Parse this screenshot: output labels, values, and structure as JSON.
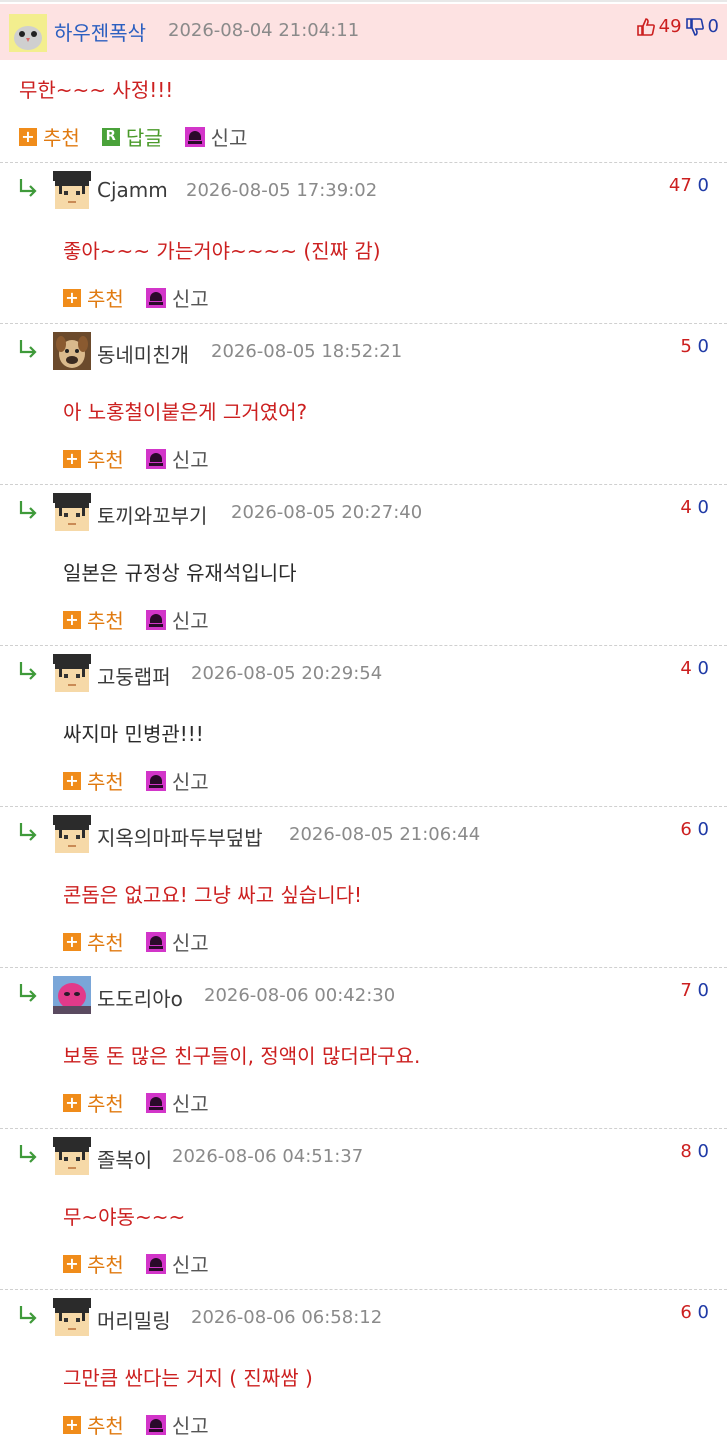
{
  "main": {
    "username": "하우젠폭삭",
    "date": "2026-08-04 21:04:11",
    "up": "49",
    "down": "0",
    "text": "무한~~~ 사정!!!",
    "recommend_label": "추천",
    "reply_label": "답글",
    "report_label": "신고"
  },
  "colors": {
    "accent_red": "#cc2020",
    "vote_blue": "#1f3aa6",
    "header_bg": "#fde2e2",
    "recommend_orange": "#f08c1a"
  },
  "replies": [
    {
      "username": "Cjamm",
      "date": "2026-08-05 17:39:02",
      "up": "47",
      "down": "0",
      "text": "좋아~~~ 가는거야~~~~ (진짜 감)",
      "recommend_label": "추천",
      "report_label": "신고"
    },
    {
      "username": "동네미친개",
      "date": "2026-08-05 18:52:21",
      "up": "5",
      "down": "0",
      "text": "아 노홍철이붙은게 그거였어?",
      "recommend_label": "추천",
      "report_label": "신고"
    },
    {
      "username": "토끼와꼬부기",
      "date": "2026-08-05 20:27:40",
      "up": "4",
      "down": "0",
      "text": "일본은 규정상 유재석입니다",
      "recommend_label": "추천",
      "report_label": "신고"
    },
    {
      "username": "고둥랩퍼",
      "date": "2026-08-05 20:29:54",
      "up": "4",
      "down": "0",
      "text": "싸지마 민병관!!!",
      "recommend_label": "추천",
      "report_label": "신고"
    },
    {
      "username": "지옥의마파두부덮밥",
      "date": "2026-08-05 21:06:44",
      "up": "6",
      "down": "0",
      "text": "콘돔은 없고요! 그냥 싸고 싶습니다!",
      "recommend_label": "추천",
      "report_label": "신고"
    },
    {
      "username": "도도리아o",
      "date": "2026-08-06 00:42:30",
      "up": "7",
      "down": "0",
      "text": "보통 돈 많은 친구들이, 정액이 많더라구요.",
      "recommend_label": "추천",
      "report_label": "신고"
    },
    {
      "username": "졸복이",
      "date": "2026-08-06 04:51:37",
      "up": "8",
      "down": "0",
      "text": "무~야동~~~",
      "recommend_label": "추천",
      "report_label": "신고"
    },
    {
      "username": "머리밀링",
      "date": "2026-08-06 06:58:12",
      "up": "6",
      "down": "0",
      "text": "그만큼 싼다는 거지 ( 진짜쌈 )",
      "recommend_label": "추천",
      "report_label": "신고"
    }
  ]
}
